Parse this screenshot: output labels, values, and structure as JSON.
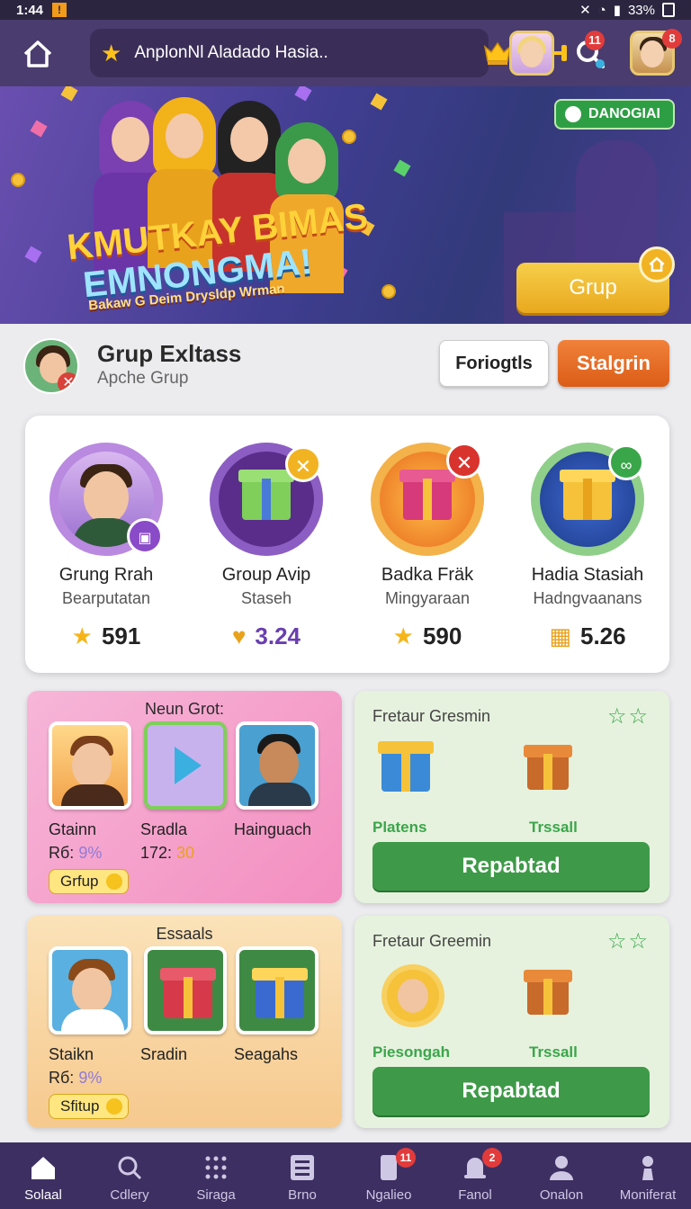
{
  "status_bar": {
    "time": "1:44",
    "battery": "33%"
  },
  "topbar": {
    "title": "AnplonNl Aladado Hasia..",
    "search_badge": "11",
    "avatar_badge": "8"
  },
  "banner": {
    "title_line1": "KMUTKAY BIMAS",
    "title_line2": "EMNONGMA!",
    "subtitle": "Bakaw G Deim Drysldp Wrman",
    "pill_label": "DANOGIAI",
    "button_label": "Grup"
  },
  "group": {
    "title": "Grup Exltass",
    "subtitle": "Apche Grup",
    "button_secondary": "Foriogtls",
    "button_primary": "Stalgrin"
  },
  "featured": [
    {
      "name": "Grung Rrah",
      "sub": "Bearputatan",
      "value": "591"
    },
    {
      "name": "Group Avip",
      "sub": "Staseh",
      "value": "3.24"
    },
    {
      "name": "Badka Fräk",
      "sub": "Mingyaraan",
      "value": "590"
    },
    {
      "name": "Hadia Stasiah",
      "sub": "Hadngvaanans",
      "value": "5.26"
    }
  ],
  "card_pink": {
    "header": "Neun Grot:",
    "tiles": [
      "Gtainn",
      "Sradla",
      "Hainguach"
    ],
    "value1_prefix": "Rб: ",
    "value1_accent": "9%",
    "value2_prefix": "172: ",
    "value2_accent": "30",
    "chip": "Grfup"
  },
  "card_peach": {
    "header": "Essaals",
    "tiles": [
      "Staikn",
      "Sradin",
      "Seagahs"
    ],
    "value1_prefix": "Rб: ",
    "value1_accent": "9%",
    "chip": "Sfitup"
  },
  "card_green1": {
    "title": "Fretaur Gresmin",
    "left_label": "Platens",
    "right_label": "Trssall",
    "button": "Repabtad"
  },
  "card_green2": {
    "title": "Fretaur Greemin",
    "left_label": "Piesongah",
    "right_label": "Trssall",
    "button": "Repabtad"
  },
  "nav": [
    {
      "label": "Solaal",
      "icon": "home-icon"
    },
    {
      "label": "Cdlery",
      "icon": "search-icon"
    },
    {
      "label": "Siraga",
      "icon": "grid-icon"
    },
    {
      "label": "Brno",
      "icon": "list-icon"
    },
    {
      "label": "Ngalieo",
      "icon": "phone-icon",
      "badge": "11"
    },
    {
      "label": "Fanol",
      "icon": "bell-icon",
      "badge": "2"
    },
    {
      "label": "Onalon",
      "icon": "person-icon"
    },
    {
      "label": "Moniferat",
      "icon": "profile-icon"
    }
  ],
  "colors": {
    "accent_purple": "#4a3c6e",
    "accent_orange": "#db5d17",
    "accent_green": "#3e9a48",
    "gold": "#ffc21a"
  }
}
